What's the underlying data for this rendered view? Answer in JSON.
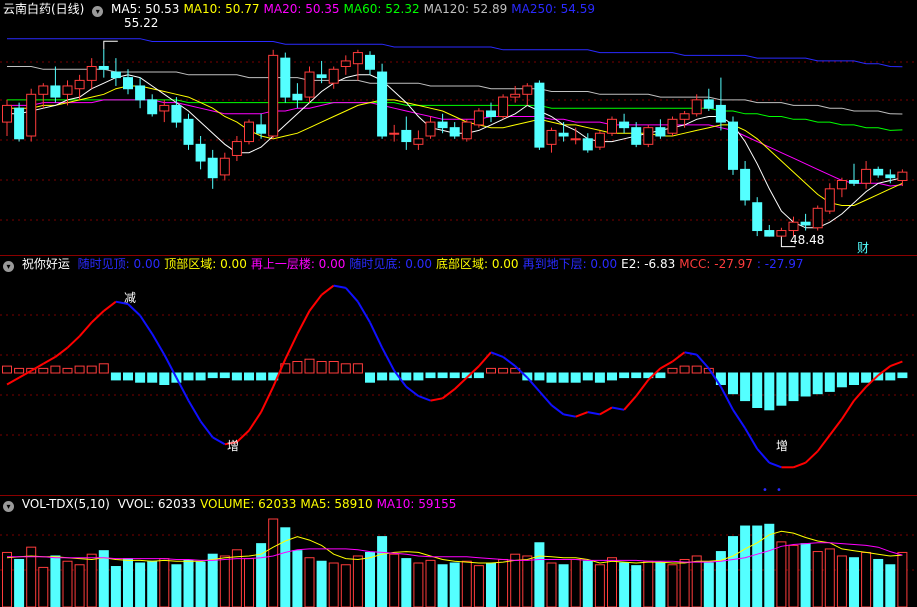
{
  "colors": {
    "up": "#ff3c3c",
    "down": "#54ffff",
    "ma5": "#ffffff",
    "ma10": "#ffff00",
    "ma20": "#ff00ff",
    "ma60": "#00ff00",
    "ma120": "#c0c0c0",
    "ma250": "#2a2aff",
    "mcc_up": "#ff0000",
    "mcc_down": "#1010ff"
  },
  "price_panel": {
    "title": "云南白药(日线)",
    "indicators": [
      {
        "label": "MA5: 50.53",
        "color": "#ffffff"
      },
      {
        "label": "MA10: 50.77",
        "color": "#ffff00"
      },
      {
        "label": "MA20: 50.35",
        "color": "#ff00ff"
      },
      {
        "label": "MA60: 52.32",
        "color": "#00ff00"
      },
      {
        "label": "MA120: 52.89",
        "color": "#c0c0c0"
      },
      {
        "label": "MA250: 54.59",
        "color": "#2a2aff"
      }
    ],
    "high_marker": "55.22",
    "low_marker": "48.48",
    "fin_badge": "财"
  },
  "indicator_panel": {
    "title": "祝你好运",
    "items": [
      {
        "label": "随时见顶: 0.00",
        "color": "#2a2aff"
      },
      {
        "label": "顶部区域: 0.00",
        "color": "#ffff00"
      },
      {
        "label": "再上一层楼: 0.00",
        "color": "#ff00ff"
      },
      {
        "label": "随时见底: 0.00",
        "color": "#2a2aff"
      },
      {
        "label": "底部区域: 0.00",
        "color": "#ffff00"
      },
      {
        "label": "再到地下层: 0.00",
        "color": "#2a2aff"
      },
      {
        "label": "E2: -6.83",
        "color": "#ffffff"
      },
      {
        "label": "MCC: -27.97",
        "color": "#ff3c3c"
      },
      {
        "label": ": -27.97",
        "color": "#2a2aff"
      }
    ],
    "signal_reduce": "减",
    "signal_increase_1": "增",
    "signal_increase_2": "增"
  },
  "volume_panel": {
    "title": "VOL-TDX(5,10)",
    "items": [
      {
        "label": "VVOL: 62033",
        "color": "#ffffff"
      },
      {
        "label": "VOLUME: 62033",
        "color": "#ffff00"
      },
      {
        "label": "MA5: 58910",
        "color": "#ffff00"
      },
      {
        "label": "MA10: 59155",
        "color": "#ff00ff"
      }
    ]
  },
  "chart_data": {
    "type": "candlestick",
    "candles": [
      [
        52.6,
        53.4,
        52.1,
        53.2
      ],
      [
        53.1,
        53.3,
        51.9,
        52.0
      ],
      [
        52.1,
        53.8,
        51.9,
        53.6
      ],
      [
        53.6,
        54.0,
        53.1,
        53.9
      ],
      [
        53.9,
        54.6,
        53.3,
        53.5
      ],
      [
        53.6,
        54.1,
        53.2,
        53.9
      ],
      [
        53.8,
        54.3,
        53.4,
        54.1
      ],
      [
        54.1,
        54.9,
        53.8,
        54.6
      ],
      [
        54.6,
        55.22,
        54.2,
        54.5
      ],
      [
        54.4,
        54.9,
        53.9,
        54.2
      ],
      [
        54.2,
        54.5,
        53.6,
        53.8
      ],
      [
        53.9,
        54.2,
        53.1,
        53.4
      ],
      [
        53.4,
        53.6,
        52.8,
        52.9
      ],
      [
        53.0,
        53.4,
        52.6,
        53.2
      ],
      [
        53.2,
        53.5,
        52.4,
        52.6
      ],
      [
        52.7,
        52.9,
        51.6,
        51.8
      ],
      [
        51.8,
        52.1,
        50.9,
        51.2
      ],
      [
        51.3,
        51.6,
        50.2,
        50.6
      ],
      [
        50.7,
        51.5,
        50.5,
        51.3
      ],
      [
        51.4,
        52.1,
        51.2,
        51.9
      ],
      [
        51.9,
        52.7,
        51.8,
        52.6
      ],
      [
        52.5,
        52.9,
        52.0,
        52.2
      ],
      [
        52.1,
        55.2,
        52.0,
        55.0
      ],
      [
        54.9,
        55.1,
        53.3,
        53.5
      ],
      [
        53.6,
        54.0,
        53.1,
        53.4
      ],
      [
        53.5,
        54.6,
        53.3,
        54.4
      ],
      [
        54.3,
        54.8,
        54.0,
        54.2
      ],
      [
        54.0,
        54.6,
        53.8,
        54.5
      ],
      [
        54.6,
        55.0,
        54.3,
        54.8
      ],
      [
        54.7,
        55.2,
        54.1,
        55.1
      ],
      [
        55.0,
        55.15,
        54.3,
        54.5
      ],
      [
        54.4,
        54.7,
        52.0,
        52.1
      ],
      [
        52.2,
        52.5,
        51.9,
        52.2
      ],
      [
        52.3,
        52.8,
        51.6,
        51.9
      ],
      [
        51.8,
        52.3,
        51.6,
        52.0
      ],
      [
        52.1,
        52.8,
        52.0,
        52.6
      ],
      [
        52.6,
        52.9,
        52.2,
        52.4
      ],
      [
        52.4,
        52.6,
        52.0,
        52.1
      ],
      [
        52.0,
        52.7,
        51.9,
        52.6
      ],
      [
        52.5,
        53.1,
        52.4,
        53.0
      ],
      [
        53.0,
        53.3,
        52.6,
        52.8
      ],
      [
        52.8,
        53.6,
        52.7,
        53.5
      ],
      [
        53.5,
        53.9,
        53.3,
        53.6
      ],
      [
        53.6,
        54.0,
        53.2,
        53.9
      ],
      [
        54.0,
        54.1,
        51.6,
        51.7
      ],
      [
        51.8,
        52.4,
        51.5,
        52.3
      ],
      [
        52.2,
        52.6,
        51.9,
        52.1
      ],
      [
        52.0,
        52.4,
        51.8,
        52.0
      ],
      [
        52.0,
        52.2,
        51.5,
        51.6
      ],
      [
        51.7,
        52.3,
        51.6,
        52.2
      ],
      [
        52.2,
        52.8,
        52.1,
        52.7
      ],
      [
        52.6,
        52.9,
        52.2,
        52.4
      ],
      [
        52.4,
        52.6,
        51.7,
        51.8
      ],
      [
        51.8,
        52.5,
        51.7,
        52.4
      ],
      [
        52.4,
        52.7,
        52.0,
        52.1
      ],
      [
        52.2,
        52.8,
        52.1,
        52.7
      ],
      [
        52.7,
        53.0,
        52.4,
        52.9
      ],
      [
        52.9,
        53.6,
        52.8,
        53.4
      ],
      [
        53.4,
        53.8,
        53.0,
        53.1
      ],
      [
        53.2,
        54.2,
        52.3,
        52.6
      ],
      [
        52.6,
        52.8,
        50.7,
        50.9
      ],
      [
        50.9,
        51.2,
        49.6,
        49.8
      ],
      [
        49.7,
        49.9,
        48.5,
        48.7
      ],
      [
        48.7,
        48.9,
        48.48,
        48.5
      ],
      [
        48.5,
        48.8,
        48.48,
        48.7
      ],
      [
        48.7,
        49.2,
        48.5,
        49.0
      ],
      [
        49.0,
        49.3,
        48.7,
        48.9
      ],
      [
        48.8,
        49.6,
        48.7,
        49.5
      ],
      [
        49.4,
        50.4,
        49.3,
        50.2
      ],
      [
        50.2,
        50.6,
        49.9,
        50.5
      ],
      [
        50.5,
        51.1,
        50.3,
        50.4
      ],
      [
        50.4,
        51.2,
        50.2,
        50.9
      ],
      [
        50.9,
        51.0,
        50.6,
        50.7
      ],
      [
        50.7,
        50.9,
        50.4,
        50.6
      ],
      [
        50.5,
        50.9,
        50.3,
        50.8
      ]
    ],
    "price_range": [
      48,
      56.2
    ],
    "ma5": [
      52.9,
      52.9,
      53.0,
      53.1,
      53.2,
      53.4,
      53.5,
      53.8,
      54.0,
      54.2,
      54.3,
      54.2,
      53.9,
      53.6,
      53.3,
      53.0,
      52.6,
      52.2,
      51.8,
      51.5,
      51.5,
      51.7,
      52.1,
      52.5,
      52.9,
      53.3,
      53.7,
      54.0,
      54.2,
      54.3,
      54.3,
      54.1,
      53.7,
      53.3,
      52.8,
      52.4,
      52.3,
      52.2,
      52.2,
      52.3,
      52.5,
      52.7,
      52.9,
      53.2,
      53.0,
      52.8,
      52.5,
      52.3,
      52.0,
      51.9,
      51.9,
      52.0,
      52.1,
      52.2,
      52.3,
      52.4,
      52.5,
      52.7,
      52.8,
      52.8,
      52.5,
      51.9,
      51.1,
      50.2,
      49.4,
      49.0,
      48.8,
      48.8,
      49.0,
      49.3,
      49.7,
      50.1,
      50.4,
      50.5,
      50.6
    ],
    "ma10": [
      53.1,
      53.1,
      53.1,
      53.2,
      53.2,
      53.3,
      53.4,
      53.5,
      53.6,
      53.8,
      53.9,
      53.9,
      53.8,
      53.7,
      53.6,
      53.5,
      53.3,
      53.1,
      52.8,
      52.6,
      52.3,
      52.1,
      52.0,
      52.1,
      52.2,
      52.4,
      52.6,
      52.8,
      53.0,
      53.2,
      53.3,
      53.4,
      53.4,
      53.3,
      53.2,
      53.1,
      53.0,
      52.8,
      52.6,
      52.5,
      52.4,
      52.4,
      52.5,
      52.6,
      52.7,
      52.6,
      52.5,
      52.5,
      52.4,
      52.3,
      52.2,
      52.2,
      52.2,
      52.2,
      52.1,
      52.1,
      52.2,
      52.3,
      52.4,
      52.5,
      52.5,
      52.3,
      52.0,
      51.6,
      51.2,
      50.8,
      50.4,
      50.0,
      49.7,
      49.6,
      49.6,
      49.8,
      50.0,
      50.2,
      50.4
    ],
    "ma20": [
      53.2,
      53.2,
      53.2,
      53.3,
      53.3,
      53.3,
      53.3,
      53.3,
      53.4,
      53.4,
      53.4,
      53.4,
      53.4,
      53.3,
      53.3,
      53.2,
      53.1,
      53.0,
      52.9,
      52.9,
      52.9,
      52.9,
      53.0,
      53.0,
      53.1,
      53.1,
      53.2,
      53.3,
      53.3,
      53.3,
      53.3,
      53.2,
      53.1,
      53.0,
      52.9,
      52.8,
      52.7,
      52.7,
      52.7,
      52.7,
      52.8,
      52.8,
      52.8,
      52.8,
      52.8,
      52.7,
      52.7,
      52.6,
      52.6,
      52.6,
      52.5,
      52.5,
      52.5,
      52.5,
      52.5,
      52.5,
      52.5,
      52.5,
      52.5,
      52.4,
      52.3,
      52.1,
      51.9,
      51.7,
      51.5,
      51.3,
      51.1,
      50.9,
      50.7,
      50.5,
      50.4,
      50.4,
      50.4,
      50.3,
      50.35
    ],
    "ma60": [
      53.4,
      53.4,
      53.4,
      53.4,
      53.4,
      53.4,
      53.4,
      53.4,
      53.4,
      53.4,
      53.4,
      53.4,
      53.4,
      53.4,
      53.4,
      53.3,
      53.3,
      53.3,
      53.3,
      53.3,
      53.3,
      53.3,
      53.3,
      53.3,
      53.3,
      53.3,
      53.3,
      53.3,
      53.3,
      53.3,
      53.3,
      53.3,
      53.3,
      53.2,
      53.2,
      53.2,
      53.2,
      53.2,
      53.2,
      53.2,
      53.2,
      53.2,
      53.2,
      53.2,
      53.2,
      53.1,
      53.1,
      53.1,
      53.1,
      53.1,
      53.1,
      53.1,
      53.1,
      53.1,
      53.1,
      53.1,
      53.1,
      53.1,
      53.1,
      53.0,
      53.0,
      52.9,
      52.9,
      52.8,
      52.8,
      52.7,
      52.7,
      52.6,
      52.6,
      52.5,
      52.5,
      52.4,
      52.4,
      52.3,
      52.32
    ],
    "ma120": [
      54.6,
      54.6,
      54.6,
      54.5,
      54.5,
      54.5,
      54.5,
      54.5,
      54.5,
      54.4,
      54.4,
      54.4,
      54.4,
      54.4,
      54.4,
      54.3,
      54.3,
      54.3,
      54.3,
      54.3,
      54.2,
      54.2,
      54.2,
      54.2,
      54.2,
      54.1,
      54.1,
      54.1,
      54.1,
      54.1,
      54.0,
      54.0,
      54.0,
      54.0,
      54.0,
      53.9,
      53.9,
      53.9,
      53.9,
      53.9,
      53.8,
      53.8,
      53.8,
      53.8,
      53.8,
      53.7,
      53.7,
      53.7,
      53.7,
      53.6,
      53.6,
      53.6,
      53.6,
      53.6,
      53.5,
      53.5,
      53.5,
      53.5,
      53.5,
      53.4,
      53.4,
      53.4,
      53.3,
      53.3,
      53.3,
      53.2,
      53.2,
      53.2,
      53.1,
      53.1,
      53.0,
      53.0,
      53.0,
      52.9,
      52.89
    ],
    "ma250": [
      55.6,
      55.6,
      55.6,
      55.6,
      55.6,
      55.6,
      55.6,
      55.6,
      55.6,
      55.6,
      55.6,
      55.6,
      55.5,
      55.5,
      55.5,
      55.5,
      55.5,
      55.5,
      55.5,
      55.5,
      55.5,
      55.5,
      55.5,
      55.4,
      55.4,
      55.4,
      55.4,
      55.4,
      55.4,
      55.4,
      55.4,
      55.4,
      55.3,
      55.3,
      55.3,
      55.3,
      55.3,
      55.3,
      55.3,
      55.3,
      55.3,
      55.2,
      55.2,
      55.2,
      55.2,
      55.2,
      55.2,
      55.2,
      55.2,
      55.1,
      55.1,
      55.1,
      55.1,
      55.1,
      55.1,
      55.1,
      55.0,
      55.0,
      55.0,
      55.0,
      55.0,
      55.0,
      54.9,
      54.9,
      54.9,
      54.9,
      54.9,
      54.8,
      54.8,
      54.8,
      54.8,
      54.7,
      54.7,
      54.6,
      54.59
    ],
    "mcc": [
      -5,
      -2,
      1,
      4,
      7,
      11,
      16,
      22,
      27,
      31,
      30,
      25,
      17,
      8,
      -2,
      -12,
      -21,
      -28,
      -31,
      -30,
      -25,
      -17,
      -6,
      6,
      17,
      27,
      34,
      38,
      37,
      31,
      22,
      11,
      1,
      -6,
      -10,
      -12,
      -11,
      -7,
      -2,
      3,
      9,
      7,
      3,
      -2,
      -8,
      -14,
      -18,
      -19,
      -17,
      -18,
      -15,
      -16,
      -10,
      -3,
      2,
      5,
      9,
      8,
      2,
      -6,
      -16,
      -24,
      -33,
      -39,
      -41,
      -41,
      -39,
      -34,
      -27,
      -20,
      -12,
      -6,
      -1,
      3,
      5
    ],
    "bars": [
      3,
      2,
      2,
      2,
      3,
      2,
      3,
      3,
      4,
      -3,
      -3,
      -4,
      -4,
      -5,
      -4,
      -3,
      -3,
      -2,
      -2,
      -3,
      -3,
      -3,
      -3,
      4,
      5,
      6,
      5,
      5,
      4,
      4,
      -4,
      -3,
      -3,
      -3,
      -3,
      -2,
      -2,
      -2,
      -2,
      -2,
      2,
      2,
      2,
      -3,
      -3,
      -4,
      -4,
      -4,
      -3,
      -4,
      -3,
      -2,
      -2,
      -2,
      -2,
      2,
      3,
      3,
      2,
      -5,
      -9,
      -12,
      -15,
      -16,
      -14,
      -12,
      -10,
      -9,
      -8,
      -6,
      -5,
      -4,
      -3,
      -3,
      -2
    ],
    "volume": [
      62,
      54,
      68,
      45,
      58,
      52,
      48,
      60,
      64,
      46,
      55,
      50,
      52,
      55,
      48,
      53,
      51,
      60,
      58,
      65,
      55,
      72,
      100,
      90,
      64,
      56,
      52,
      50,
      48,
      58,
      62,
      80,
      60,
      55,
      50,
      53,
      48,
      50,
      52,
      47,
      50,
      54,
      60,
      58,
      73,
      50,
      48,
      54,
      52,
      48,
      56,
      50,
      47,
      52,
      50,
      48,
      54,
      58,
      50,
      63,
      80,
      92,
      92,
      94,
      74,
      70,
      72,
      63,
      66,
      58,
      56,
      62,
      54,
      48,
      62
    ],
    "vol_ma5": [
      56,
      57,
      58,
      57,
      57,
      56,
      55,
      54,
      56,
      54,
      53,
      53,
      52,
      53,
      52,
      52,
      52,
      54,
      56,
      57,
      58,
      60,
      68,
      75,
      80,
      76,
      70,
      60,
      55,
      54,
      56,
      60,
      62,
      63,
      62,
      58,
      54,
      52,
      51,
      50,
      50,
      51,
      53,
      54,
      58,
      57,
      56,
      56,
      54,
      50,
      52,
      51,
      50,
      51,
      51,
      50,
      50,
      52,
      52,
      53,
      58,
      66,
      73,
      82,
      86,
      84,
      79,
      75,
      73,
      66,
      64,
      62,
      60,
      58,
      59
    ],
    "vol_ma10": [
      57,
      57,
      57,
      57,
      56,
      56,
      56,
      56,
      56,
      55,
      55,
      55,
      55,
      55,
      54,
      54,
      53,
      53,
      54,
      55,
      55,
      56,
      58,
      62,
      65,
      66,
      66,
      66,
      66,
      65,
      63,
      62,
      61,
      60,
      58,
      57,
      57,
      57,
      57,
      56,
      55,
      54,
      53,
      53,
      54,
      54,
      54,
      54,
      53,
      53,
      53,
      53,
      53,
      52,
      52,
      52,
      51,
      51,
      51,
      52,
      54,
      56,
      60,
      64,
      69,
      71,
      72,
      73,
      73,
      72,
      71,
      70,
      68,
      63,
      59
    ]
  }
}
